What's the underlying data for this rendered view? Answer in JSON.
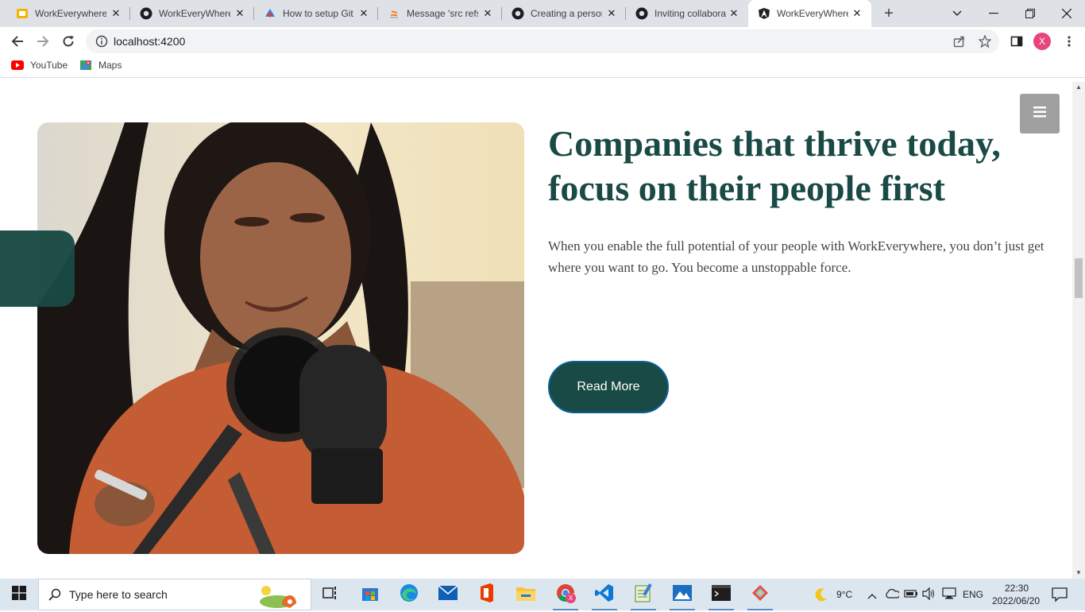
{
  "browser": {
    "tabs": [
      {
        "title": "WorkEverywhere",
        "icon": "slides-icon"
      },
      {
        "title": "WorkEveryWhere",
        "icon": "github-icon"
      },
      {
        "title": "How to setup Git",
        "icon": "blog-icon"
      },
      {
        "title": "Message 'src refs",
        "icon": "stackoverflow-icon"
      },
      {
        "title": "Creating a person",
        "icon": "github-icon"
      },
      {
        "title": "Inviting collabora",
        "icon": "github-icon"
      },
      {
        "title": "WorkEveryWhere",
        "icon": "angular-icon",
        "active": true
      }
    ],
    "url": "localhost:4200",
    "profile_initial": "X",
    "bookmarks": [
      {
        "label": "YouTube",
        "icon": "youtube-icon"
      },
      {
        "label": "Maps",
        "icon": "maps-icon"
      }
    ]
  },
  "page": {
    "headline": "Companies that thrive today, focus on their people first",
    "body": "When you enable the full potential of your people with WorkEverywhere, you don’t just get where you want to go. You become a unstoppable force.",
    "cta_label": "Read More",
    "hero_image": "woman speaking into studio microphone",
    "accent_color": "#1a4a45"
  },
  "taskbar": {
    "search_placeholder": "Type here to search",
    "weather": "9°C",
    "language": "ENG",
    "time": "22:30",
    "date": "2022/06/20",
    "chrome_badge": "X"
  }
}
